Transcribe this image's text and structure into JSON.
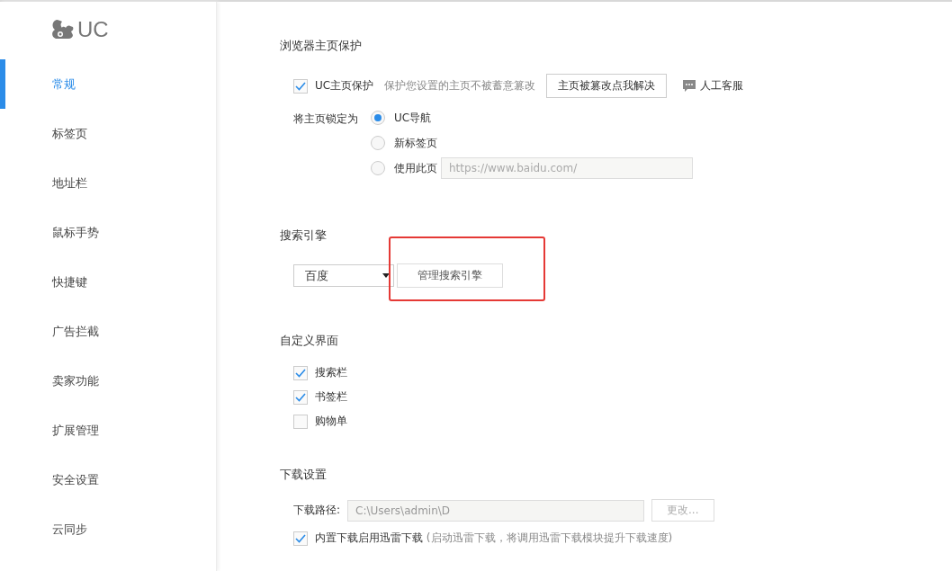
{
  "logo": {
    "text": "UC"
  },
  "sidebar": {
    "items": [
      {
        "label": "常规",
        "selected": true
      },
      {
        "label": "标签页",
        "selected": false
      },
      {
        "label": "地址栏",
        "selected": false
      },
      {
        "label": "鼠标手势",
        "selected": false
      },
      {
        "label": "快捷键",
        "selected": false
      },
      {
        "label": "广告拦截",
        "selected": false
      },
      {
        "label": "卖家功能",
        "selected": false
      },
      {
        "label": "扩展管理",
        "selected": false
      },
      {
        "label": "安全设置",
        "selected": false
      },
      {
        "label": "云同步",
        "selected": false
      }
    ]
  },
  "homepage": {
    "title": "浏览器主页保护",
    "protect": {
      "label": "UC主页保护",
      "checked": true
    },
    "hint": "保护您设置的主页不被蓄意篡改",
    "fix_button": "主页被篡改点我解决",
    "support_link": "人工客服",
    "lock_label": "将主页锁定为",
    "options": [
      {
        "label": "UC导航",
        "selected": true
      },
      {
        "label": "新标签页",
        "selected": false
      },
      {
        "label": "使用此页",
        "selected": false,
        "placeholder": "https://www.baidu.com/"
      }
    ]
  },
  "search": {
    "title": "搜索引擎",
    "engine": "百度",
    "manage_button": "管理搜索引擎"
  },
  "ui": {
    "title": "自定义界面",
    "items": [
      {
        "label": "搜索栏",
        "checked": true
      },
      {
        "label": "书签栏",
        "checked": true
      },
      {
        "label": "购物单",
        "checked": false
      }
    ]
  },
  "download": {
    "title": "下载设置",
    "path_label": "下载路径:",
    "path": "C:\\Users\\admin\\D",
    "change_button": "更改...",
    "thunder": {
      "label": "内置下载启用迅雷下载",
      "note": "(启动迅雷下载，将调用迅雷下载模块提升下载速度)",
      "checked": true
    }
  }
}
